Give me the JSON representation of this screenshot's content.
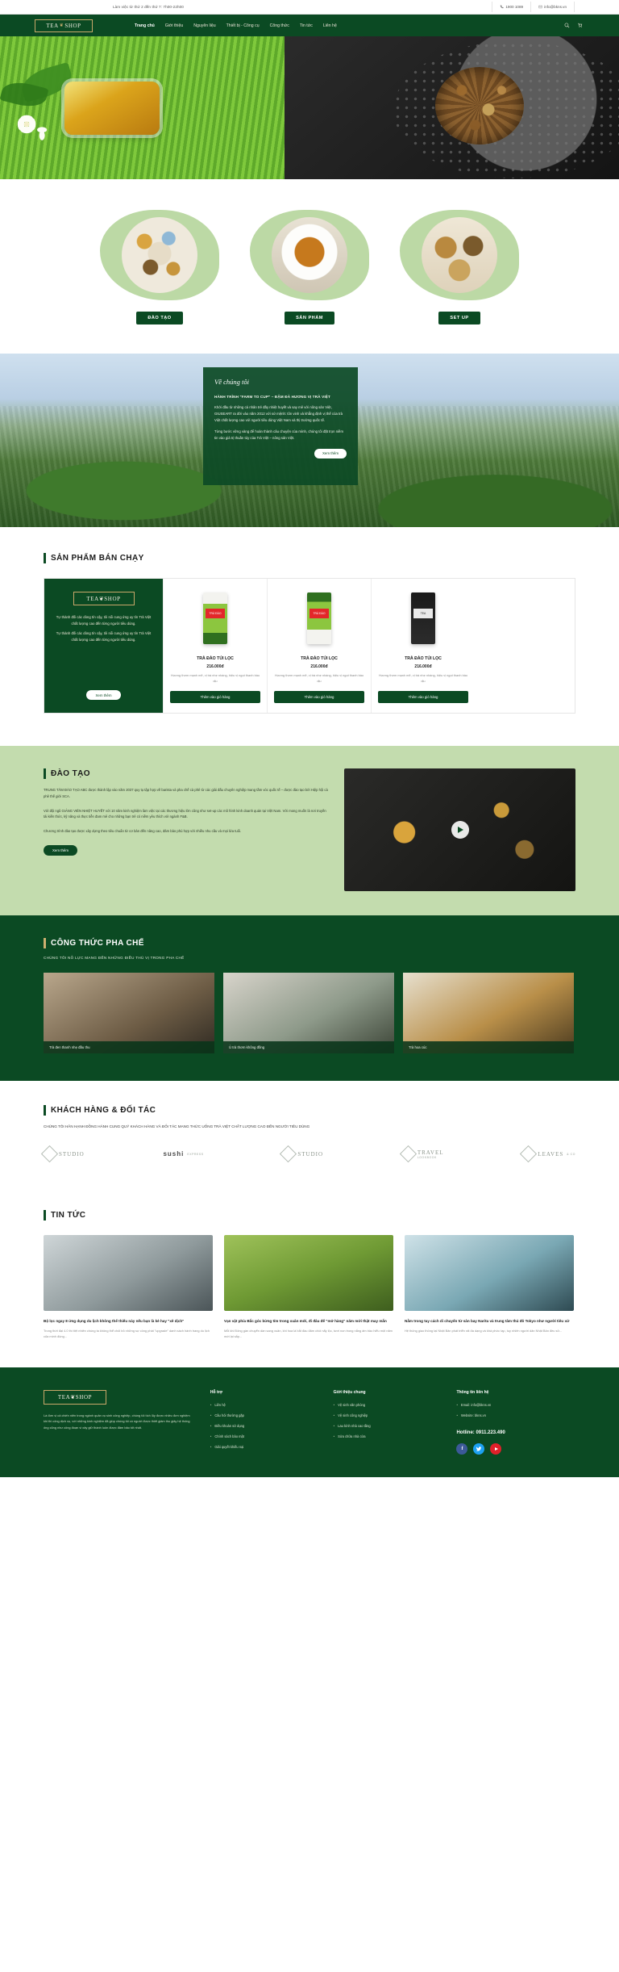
{
  "topbar": {
    "hours": "Làm việc từ thứ 2 đến thứ 7: 7h00-22h00",
    "phone": "1900 1089",
    "email": "info@bkns.vn",
    "phone_icon": "phone-icon",
    "email_icon": "envelope-icon"
  },
  "header": {
    "logo_left": "TEA",
    "logo_leaf": "❦",
    "logo_right": "SHOP",
    "nav": [
      {
        "label": "Trang chủ",
        "active": true
      },
      {
        "label": "Giới thiệu",
        "active": false
      },
      {
        "label": "Nguyên liệu",
        "active": false
      },
      {
        "label": "Thiết bị - Công cụ",
        "active": false
      },
      {
        "label": "Công thức",
        "active": false
      },
      {
        "label": "Tin tức",
        "active": false
      },
      {
        "label": "Liên hệ",
        "active": false
      }
    ],
    "search_icon": "search-icon",
    "cart_icon": "cart-icon"
  },
  "hero": {
    "alt": "Tea bowl and tea leaves banner"
  },
  "cards3": [
    {
      "label": "ĐÀO TẠO",
      "image": "tea-tasting-flatlay"
    },
    {
      "label": "SẢN PHẨM",
      "image": "tea-cup-saucer"
    },
    {
      "label": "SET UP",
      "image": "tea-bowls-spices"
    }
  ],
  "about": {
    "heading": "Về chúng tôi",
    "subheading": "HÀNH TRÌNH \"FARM TO CUP\" – ĐẬM ĐÀ HƯƠNG VỊ TRÀ VIỆT",
    "paragraph1": "Khởi đầu từ những cá nhân trẻ đầy nhiệt huyết và say mê với nông sản Việt, GIUSEART ra đời vào năm 2012 với sứ mệnh: tôn vinh và khẳng định vị thế của trà Việt chất lượng cao với người tiêu dùng Việt Nam và thị trường quốc tế.",
    "paragraph2": "Từng bước vững vàng để hoàn thành câu chuyện của mình, chúng tôi đặt trọn niềm tin vào giá trị thuần túy của Trà Việt – nông sản Việt.",
    "button": "Xem thêm"
  },
  "products": {
    "title": "SẢN PHẨM BÁN CHẠY",
    "promo": {
      "logo_left": "TEA",
      "logo_leaf": "❦",
      "logo_right": "SHOP",
      "line1": "Tự thành đối các dòng tín cậy, tôi nổi cung ứng uy tín Trà Việt chất lượng cao đến từng người tiêu dùng.",
      "line2": "Tự thành đối các dòng tín cậy, tôi nổi cung ứng uy tín Trà Việt chất lượng cao đến từng người tiêu dùng.",
      "button": "Xem thêm"
    },
    "items": [
      {
        "name": "TRÀ ĐÀO TÚI LỌC",
        "price": "216.000đ",
        "desc": "Hương thơm mạnh mẽ, vị trà nhẹ nhàng, hiệu vị ngọt thanh bào dịu",
        "button": "Thêm vào giỏ hàng",
        "pack_label": "TRÀ ĐÀO",
        "pack_style": "green-top"
      },
      {
        "name": "TRÀ ĐÀO TÚI LỌC",
        "price": "216.000đ",
        "desc": "Hương thơm mạnh mẽ, vị trà nhẹ nhàng, hiệu vị ngọt thanh bào dịu",
        "button": "Thêm vào giỏ hàng",
        "pack_label": "TRÀ ĐÀO",
        "pack_style": "green-bottom"
      },
      {
        "name": "TRÀ ĐÀO TÚI LỌC",
        "price": "216.000đ",
        "desc": "Hương thơm mạnh mẽ, vị trà nhẹ nhàng, hiệu vị ngọt thanh bào dịu",
        "button": "Thêm vào giỏ hàng",
        "pack_label": "TEA",
        "pack_style": "black"
      }
    ]
  },
  "training": {
    "title": "ĐÀO TẠO",
    "paragraph1": "TRUNG TÂM ĐÀO TẠO ABC được thành lập vào năm 2037 quy tụ tập hợp về barista và pha chế cà phê từ các giải đấu chuyên nghiệp mang tầm vóc quốc tế – được đào tạo bởi Hiệp hội cà phê thế giới SCA.",
    "paragraph2": "Với đội ngũ GIẢNG VIÊN NHIỆT HUYẾT với 10 năm kinh nghiệm làm việc tại các thương hiệu lớn cũng như set-up các mô hình kinh doanh quán tại Việt Nam. Với mong muốn là nơi truyền tải kiến thức, kỹ năng và thực tiễn đam mê cho những bạn trẻ có niềm yêu thích với ngành F&B.",
    "paragraph3": "Chương trình đào tạo được xây dựng theo tiêu chuẩn từ cơ bản đến nâng cao, đảm bảo phù hợp với nhiều nhu cầu và mọi lứa tuổi.",
    "button": "Xem thêm",
    "play_icon": "play-icon"
  },
  "recipes": {
    "title": "CÔNG THỨC PHA CHẾ",
    "subtitle": "CHÚNG TÔI NỖ LỰC MANG ĐẾN NHỮNG ĐIỀU THÚ VỊ TRONG PHA CHẾ",
    "items": [
      {
        "caption": "Trà đen thanh nhẹ đầu thu"
      },
      {
        "caption": "Ủ trà thơm không đồng"
      },
      {
        "caption": "Trà hoa cúc"
      }
    ]
  },
  "partners": {
    "title": "KHÁCH HÀNG & ĐỐI TÁC",
    "subtitle": "CHÚNG TÔI HÂN HẠNH ĐỒNG HÀNH CUNG QUÝ KHÁCH HÀNG VÀ ĐỐI TÁC MANG THỨC UỐNG TRÀ VIỆT CHẤT LƯỢNG CAO ĐẾN NGƯỜI TIÊU DÙNG",
    "logos": [
      {
        "name": "STUDIO",
        "sub": ""
      },
      {
        "name": "sushi",
        "sub": "EXPRESS"
      },
      {
        "name": "STUDIO",
        "sub": ""
      },
      {
        "name": "TRAVEL",
        "sub": "LOOKBOOK"
      },
      {
        "name": "LEAVES",
        "sub": "& CO"
      }
    ]
  },
  "news": {
    "title": "TIN TỨC",
    "items": [
      {
        "title": "Bộ lọc ngay 8 ứng dụng du lịch không thể thiếu này nếu bạn là kẻ hay \"xê dịch\"",
        "excerpt": "Trong thời đại 4.0 thì tiệt nhiên chúng ta không thể chối bỏ những sự công phát \"upgrade\" danh sách hành trang du lịch của mình đúng..."
      },
      {
        "title": "Vạn vật phía Bắc góc bừng tím trong xuân mới, đi đâu để \"mở hàng\" năm mới thật may mắn",
        "excerpt": "Mỗi khi Đông gần chuyển dần sang xuân, khi hoa lá bắt đầu đâm chồi nẩy lộc, tươi non trong nắng ấm bảo hiểu một năm mới lại sắp..."
      },
      {
        "title": "Nằm trong tay cách di chuyển từ sân bay Narita và trung tâm thủ đô Tokyo như người tiêu xứ",
        "excerpt": "Hệ thống giao thông tại Nhật Bản phát triển rất đa dạng và khá phức tạp, tuy nhiên người dân Nhật Bản đều sử..."
      }
    ]
  },
  "footer": {
    "logo_left": "TEA",
    "logo_leaf": "❦",
    "logo_right": "SHOP",
    "about": "Là đơn vị cả chiến niên trong ngành quản vụ sinh công nghiệp, chúng tôi tích lũy được nhiều đơn nghiệm khi thi công dịch vụ, với những kinh nghiệm đã giúp chúng tôi có người được thiết giám thu giây hệ thống ống cũng như công đoạn vi xây giữ thành luôn được đảm bảo tốt nhất.",
    "columns": [
      {
        "heading": "Hỗ trợ",
        "items": [
          "Liên hệ",
          "Câu hỏi thường gặp",
          "Điều khoản sử dụng",
          "Chính sách bảo mật",
          "Giải quyết khiếu nại"
        ]
      },
      {
        "heading": "Giới thiệu chung",
        "items": [
          "Vệ sinh văn phòng",
          "Vệ sinh công nghiệp",
          "Lau kính nhà cao tầng",
          "Sửa chữa nhà cửa"
        ]
      }
    ],
    "contact": {
      "heading": "Thông tin liên hệ",
      "items": [
        "Email: info@bkns.vn",
        "Website: bkns.vn"
      ],
      "hotline": "Hotline: 0911.223.490",
      "socials": [
        {
          "name": "facebook-icon",
          "glyph": "f"
        },
        {
          "name": "twitter-icon",
          "glyph": "t"
        },
        {
          "name": "youtube-icon",
          "glyph": ""
        }
      ]
    }
  }
}
